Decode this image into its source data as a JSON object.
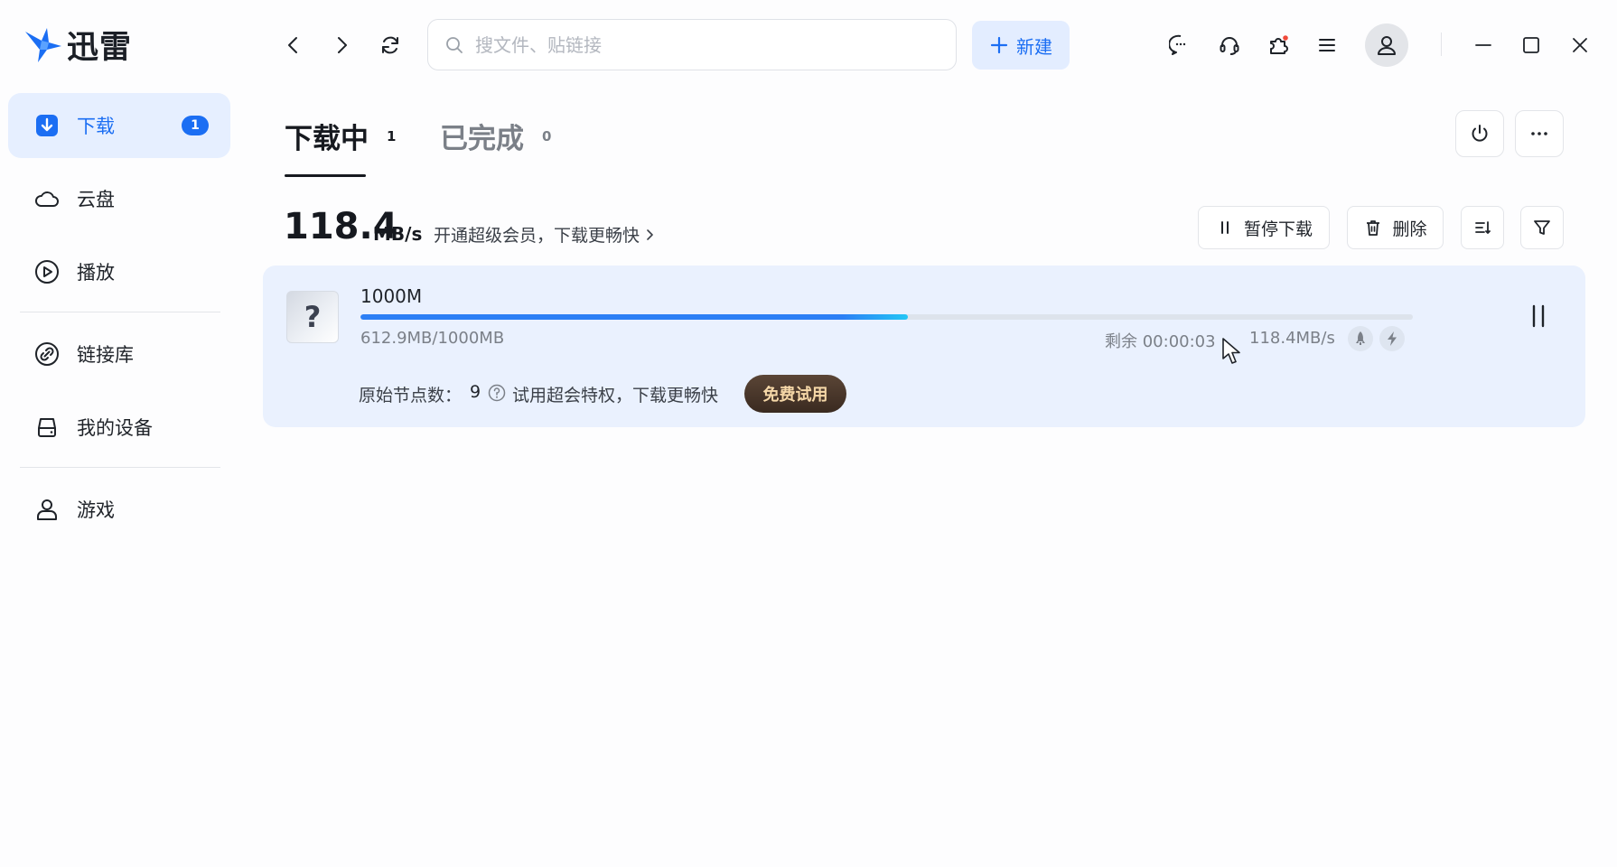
{
  "app": {
    "name": "迅雷",
    "brand_color": "#1b6ef3"
  },
  "sidebar": {
    "items": [
      {
        "label": "下载",
        "icon": "download-icon",
        "active": true,
        "badge": "1"
      },
      {
        "label": "云盘",
        "icon": "cloud-icon"
      },
      {
        "label": "播放",
        "icon": "play-icon"
      },
      {
        "label": "链接库",
        "icon": "link-icon"
      },
      {
        "label": "我的设备",
        "icon": "device-icon"
      },
      {
        "label": "游戏",
        "icon": "game-icon"
      }
    ]
  },
  "topbar": {
    "search_placeholder": "搜文件、贴链接",
    "new_label": "新建",
    "icons": [
      "back-icon",
      "forward-icon",
      "refresh-icon",
      "message-icon",
      "headset-icon",
      "plugin-icon",
      "menu-icon",
      "avatar-icon",
      "minimize-icon",
      "maximize-icon",
      "close-icon"
    ]
  },
  "tabs": [
    {
      "label": "下载中",
      "count": "1",
      "active": true
    },
    {
      "label": "已完成",
      "count": "0",
      "active": false
    }
  ],
  "toolbar": {
    "speed_value": "118.4",
    "speed_unit": "MB/s",
    "vip_promo": "开通超级会员，下载更畅快",
    "pause_all_label": "暂停下载",
    "delete_label": "删除"
  },
  "task": {
    "name": "1000M",
    "file_icon_glyph": "?",
    "progress_fraction": 0.5206,
    "size_text": "612.9MB/1000MB",
    "remaining_text": "剩余 00:00:03",
    "rate_text": "118.4MB/s",
    "nodes_label": "原始节点数：",
    "nodes_count": "9",
    "trial_text": "试用超会特权，下载更畅快",
    "trial_button": "免费试用"
  }
}
